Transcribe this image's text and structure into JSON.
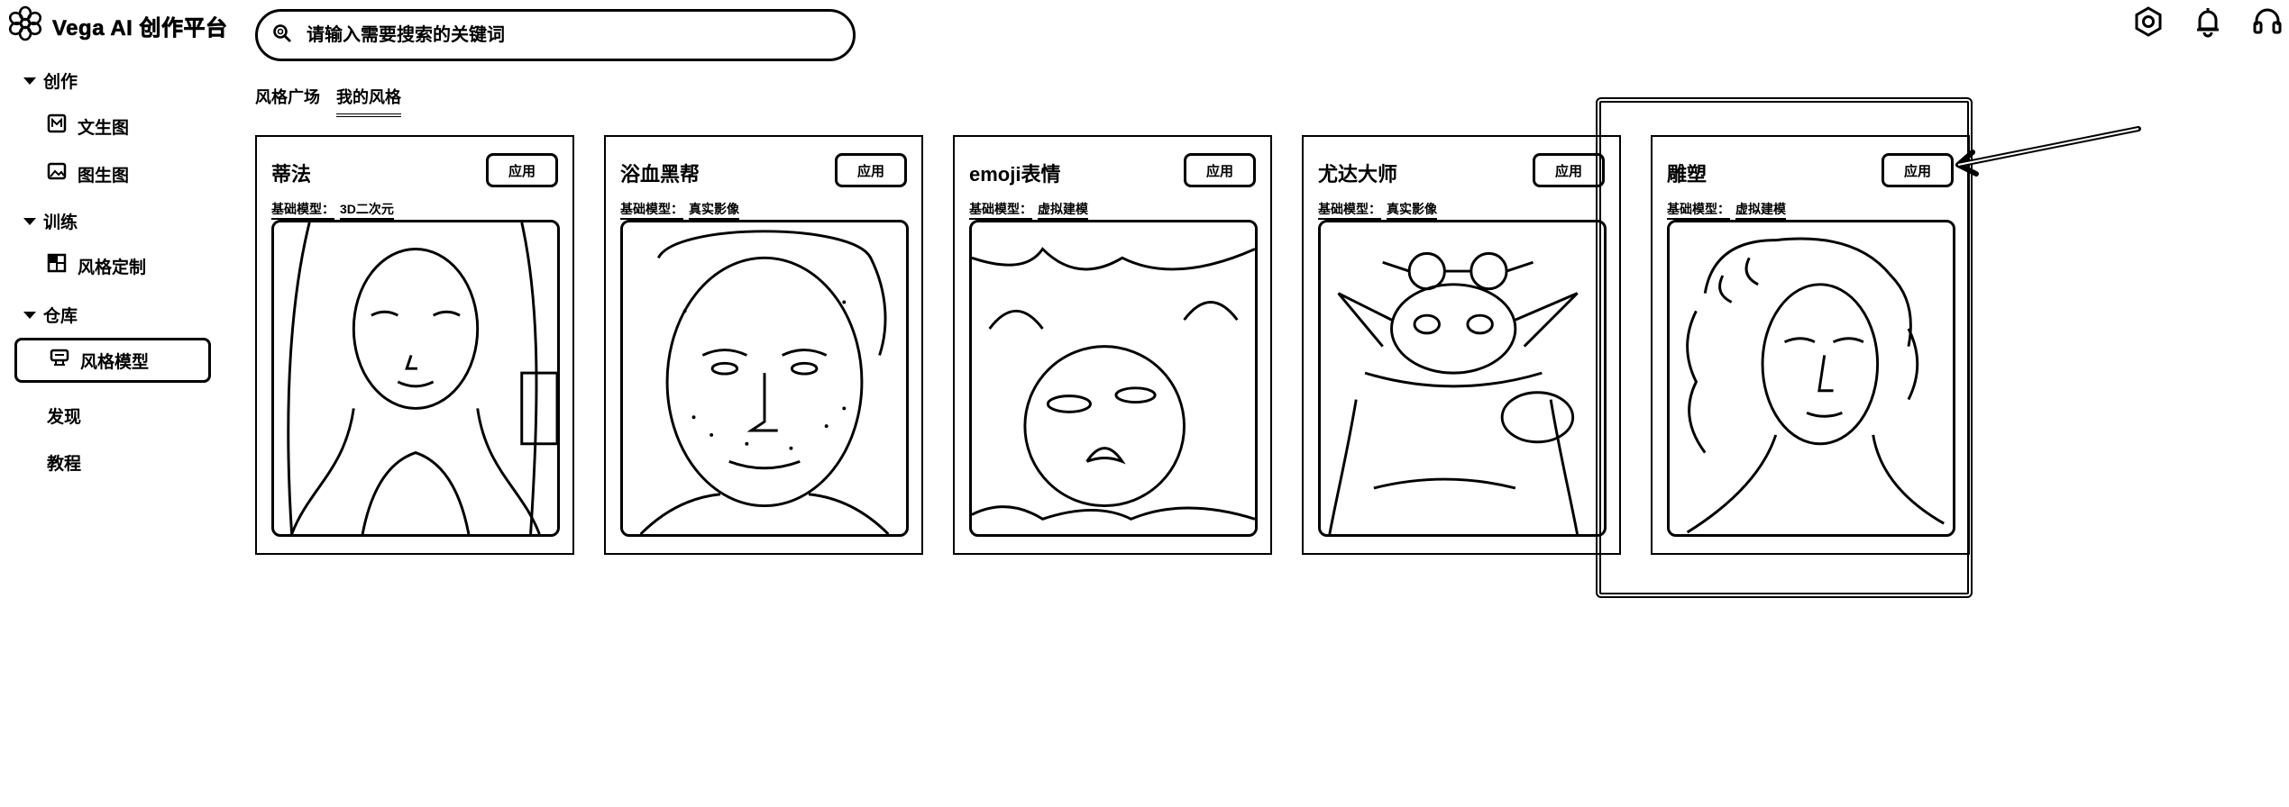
{
  "app": {
    "title": "Vega AI 创作平台"
  },
  "search": {
    "placeholder": "请输入需要搜索的关键词"
  },
  "topbar": {
    "icons": [
      "settings-icon",
      "bell-icon",
      "headset-icon"
    ]
  },
  "sidebar": {
    "sections": [
      {
        "label": "创作",
        "items": [
          {
            "label": "文生图",
            "icon": "text-image-icon"
          },
          {
            "label": "图生图",
            "icon": "image-icon"
          }
        ]
      },
      {
        "label": "训练",
        "items": [
          {
            "label": "风格定制",
            "icon": "layout-icon"
          }
        ]
      },
      {
        "label": "仓库",
        "items": [
          {
            "label": "风格模型",
            "icon": "model-icon",
            "active": true
          }
        ]
      }
    ],
    "links": [
      "发现",
      "教程"
    ]
  },
  "tabs": [
    {
      "label": "风格广场",
      "active": false
    },
    {
      "label": "我的风格",
      "active": true
    }
  ],
  "cards": [
    {
      "title": "蒂法",
      "button": "应用",
      "model_label": "基础模型：",
      "model_value": "3D二次元"
    },
    {
      "title": "浴血黑帮",
      "button": "应用",
      "model_label": "基础模型：",
      "model_value": "真实影像"
    },
    {
      "title": "emoji表情",
      "button": "应用",
      "model_label": "基础模型：",
      "model_value": "虚拟建模"
    },
    {
      "title": "尤达大师",
      "button": "应用",
      "model_label": "基础模型：",
      "model_value": "真实影像"
    },
    {
      "title": "雕塑",
      "button": "应用",
      "model_label": "基础模型：",
      "model_value": "虚拟建模"
    }
  ]
}
